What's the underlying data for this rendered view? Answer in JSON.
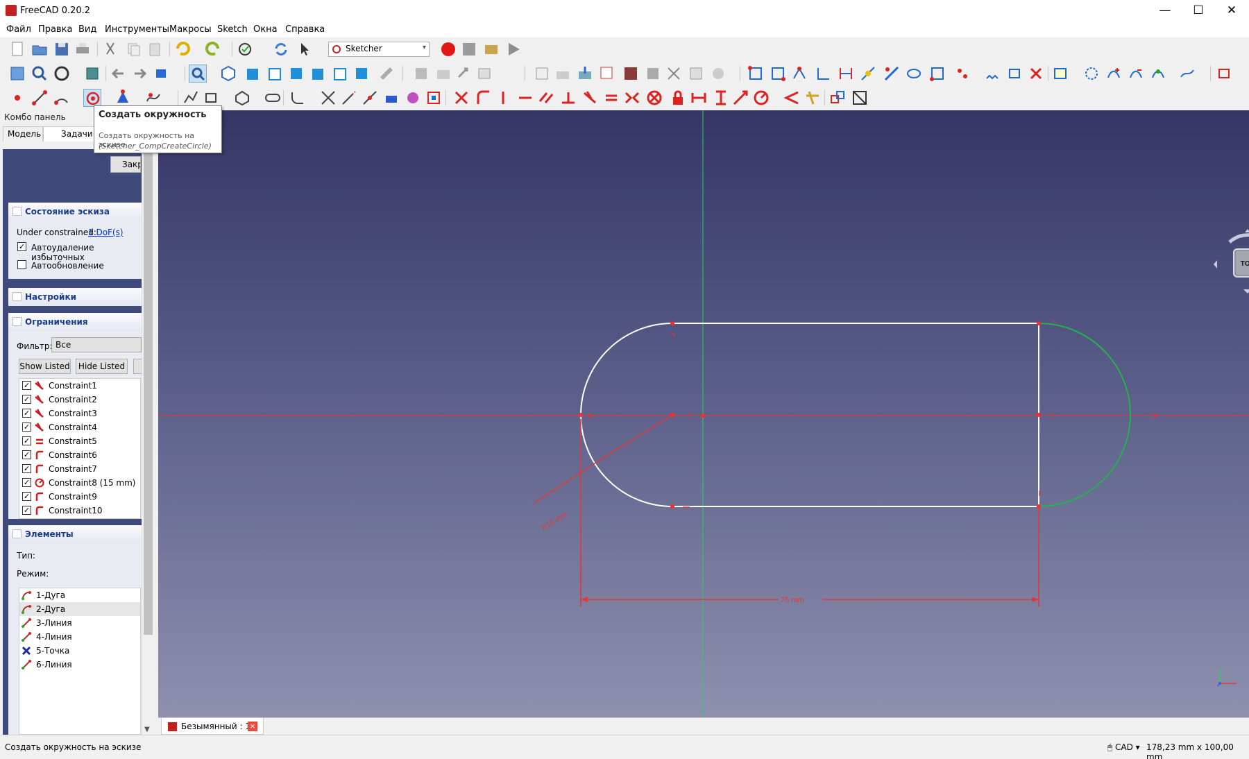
{
  "window": {
    "title": "FreeCAD 0.20.2",
    "minimize": "—",
    "maximize": "☐",
    "close": "✕"
  },
  "menu": [
    "Файл",
    "Правка",
    "Вид",
    "Инструменты",
    "Макросы",
    "Sketch",
    "Окна",
    "Справка"
  ],
  "toolbar": {
    "workbench": "Sketcher"
  },
  "tooltip": {
    "title": "Создать окружность",
    "description": "Создать окружность на эскизе",
    "command": "(Sketcher_CompCreateCircle)"
  },
  "combo": {
    "title": "Комбо панель",
    "tabs": [
      "Модель",
      "Задачи"
    ],
    "close_button": "Закрыть",
    "sketch_state": {
      "header": "Состояние эскиза",
      "under_constrained_label": "Under constrained:",
      "dof_link": "1 DoF(s)",
      "auto_remove_label": "Автоудаление избыточных",
      "auto_remove_checked": true,
      "auto_update_label": "Автообновление",
      "auto_update_checked": false
    },
    "settings": {
      "header": "Настройки"
    },
    "constraints": {
      "header": "Ограничения",
      "filter_label": "Фильтр:",
      "filter_value": "Все",
      "show_listed": "Show Listed",
      "hide_listed": "Hide Listed",
      "items": [
        {
          "label": "Constraint1",
          "icon": "tangent-constraint-icon",
          "checked": true
        },
        {
          "label": "Constraint2",
          "icon": "tangent-constraint-icon",
          "checked": true
        },
        {
          "label": "Constraint3",
          "icon": "tangent-constraint-icon",
          "checked": true
        },
        {
          "label": "Constraint4",
          "icon": "tangent-constraint-icon",
          "checked": true
        },
        {
          "label": "Constraint5",
          "icon": "equal-constraint-icon",
          "checked": true
        },
        {
          "label": "Constraint6",
          "icon": "point-on-object-constraint-icon",
          "checked": true
        },
        {
          "label": "Constraint7",
          "icon": "point-on-object-constraint-icon",
          "checked": true
        },
        {
          "label": "Constraint8 (15 mm)",
          "icon": "radius-constraint-icon",
          "checked": true
        },
        {
          "label": "Constraint9",
          "icon": "point-on-object-constraint-icon",
          "checked": true
        },
        {
          "label": "Constraint10",
          "icon": "point-on-object-constraint-icon",
          "checked": true
        }
      ]
    },
    "elements": {
      "header": "Элементы",
      "type_label": "Тип:",
      "mode_label": "Режим:",
      "items": [
        {
          "label": "1-Дуга",
          "icon": "arc-icon"
        },
        {
          "label": "2-Дуга",
          "icon": "arc-icon",
          "selected": true
        },
        {
          "label": "3-Линия",
          "icon": "line-icon"
        },
        {
          "label": "4-Линия",
          "icon": "line-icon"
        },
        {
          "label": "5-Точка",
          "icon": "point-icon"
        },
        {
          "label": "6-Линия",
          "icon": "line-icon"
        }
      ]
    }
  },
  "viewport": {
    "radius_label": "R15 mm",
    "length_label": "75 mm",
    "navcube_face": "TOP"
  },
  "document_tab": {
    "label": "Безымянный : 1*"
  },
  "statusbar": {
    "message": "Создать окружность на эскизе",
    "nav_style": "CAD",
    "dimensions": "178,23 mm x 100,00 mm"
  }
}
